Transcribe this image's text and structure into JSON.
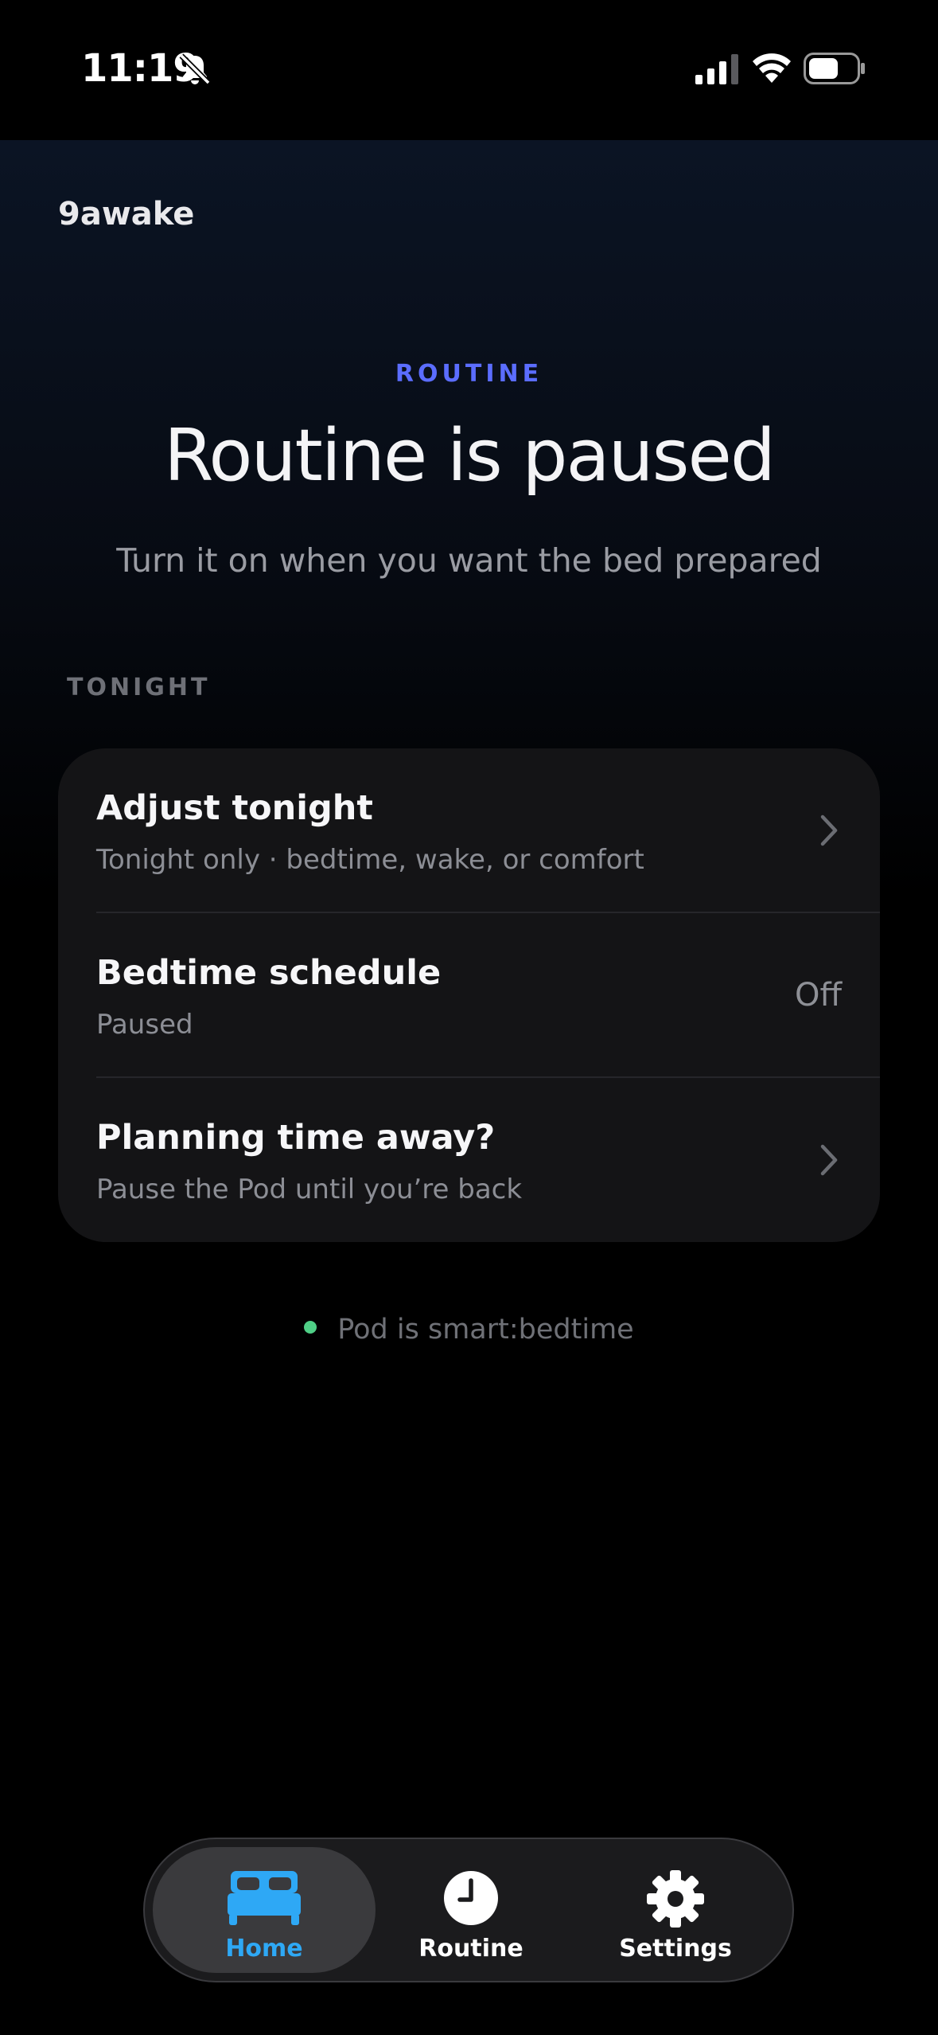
{
  "status_bar": {
    "time": "11:19",
    "icons": [
      "bell-slash-icon",
      "cellular-signal-icon",
      "wifi-icon",
      "battery-icon"
    ]
  },
  "app": {
    "name": "9awake"
  },
  "hero": {
    "eyebrow": "ROUTINE",
    "title": "Routine is paused",
    "subtitle": "Turn it on when you want the bed prepared"
  },
  "tonight": {
    "section_label": "TONIGHT",
    "rows": [
      {
        "title": "Adjust tonight",
        "subtitle": "Tonight only · bedtime, wake, or comfort",
        "accessory": "chevron-right-icon"
      },
      {
        "title": "Bedtime schedule",
        "subtitle": "Paused",
        "value": "Off"
      },
      {
        "title": "Planning time away?",
        "subtitle": "Pause the Pod until you’re back",
        "accessory": "chevron-right-icon"
      }
    ]
  },
  "pod_status": {
    "text": "Pod is smart:bedtime",
    "dot_color": "#4fcf86"
  },
  "tab_bar": {
    "selected": "home",
    "tabs": [
      {
        "id": "home",
        "label": "Home",
        "icon": "bed-icon"
      },
      {
        "id": "routine",
        "label": "Routine",
        "icon": "clock-icon"
      },
      {
        "id": "settings",
        "label": "Settings",
        "icon": "gear-icon"
      }
    ]
  },
  "colors": {
    "accent_blue": "#2ea8f5",
    "eyebrow_indigo": "#5b6dff",
    "card_background": "#141416"
  }
}
